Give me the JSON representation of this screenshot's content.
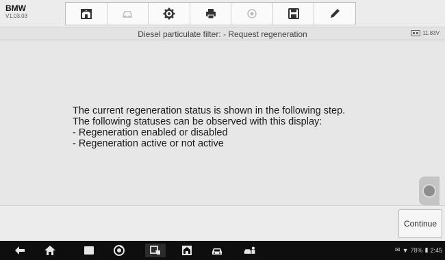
{
  "header": {
    "make": "BMW",
    "version": "V1.03.03",
    "toolbar": [
      {
        "name": "home-button",
        "icon": "home-icon"
      },
      {
        "name": "vehicle-swap-button",
        "icon": "vehicle-swap-icon",
        "state": "disabled"
      },
      {
        "name": "settings-button",
        "icon": "gear-icon"
      },
      {
        "name": "print-button",
        "icon": "printer-icon"
      },
      {
        "name": "help-button",
        "icon": "help-icon",
        "state": "disabled"
      },
      {
        "name": "save-button",
        "icon": "save-icon"
      },
      {
        "name": "edit-button",
        "icon": "pencil-icon"
      }
    ]
  },
  "title_bar": {
    "title": "Diesel particulate filter: - Request regeneration",
    "voltage": "11.83V"
  },
  "message": {
    "lines": [
      "The current regeneration status is shown in the following step.",
      "The following statuses can be observed with this display:",
      "- Regeneration enabled or disabled",
      "- Regeneration active or not active"
    ]
  },
  "actions": {
    "continue_label": "Continue"
  },
  "system_bar": {
    "battery_pct": "78%",
    "time": "2:45",
    "icons": [
      "back-icon",
      "home-icon",
      "recent-apps-icon",
      "chrome-icon",
      "screenshot-icon",
      "maxisys-home-icon",
      "car-icon",
      "vci-icon"
    ]
  },
  "colors": {
    "background": "#e7e7e7",
    "system_bar": "#0e0e0e",
    "toolbar_icon": "#333333",
    "disabled_icon": "#bbbbbb"
  }
}
